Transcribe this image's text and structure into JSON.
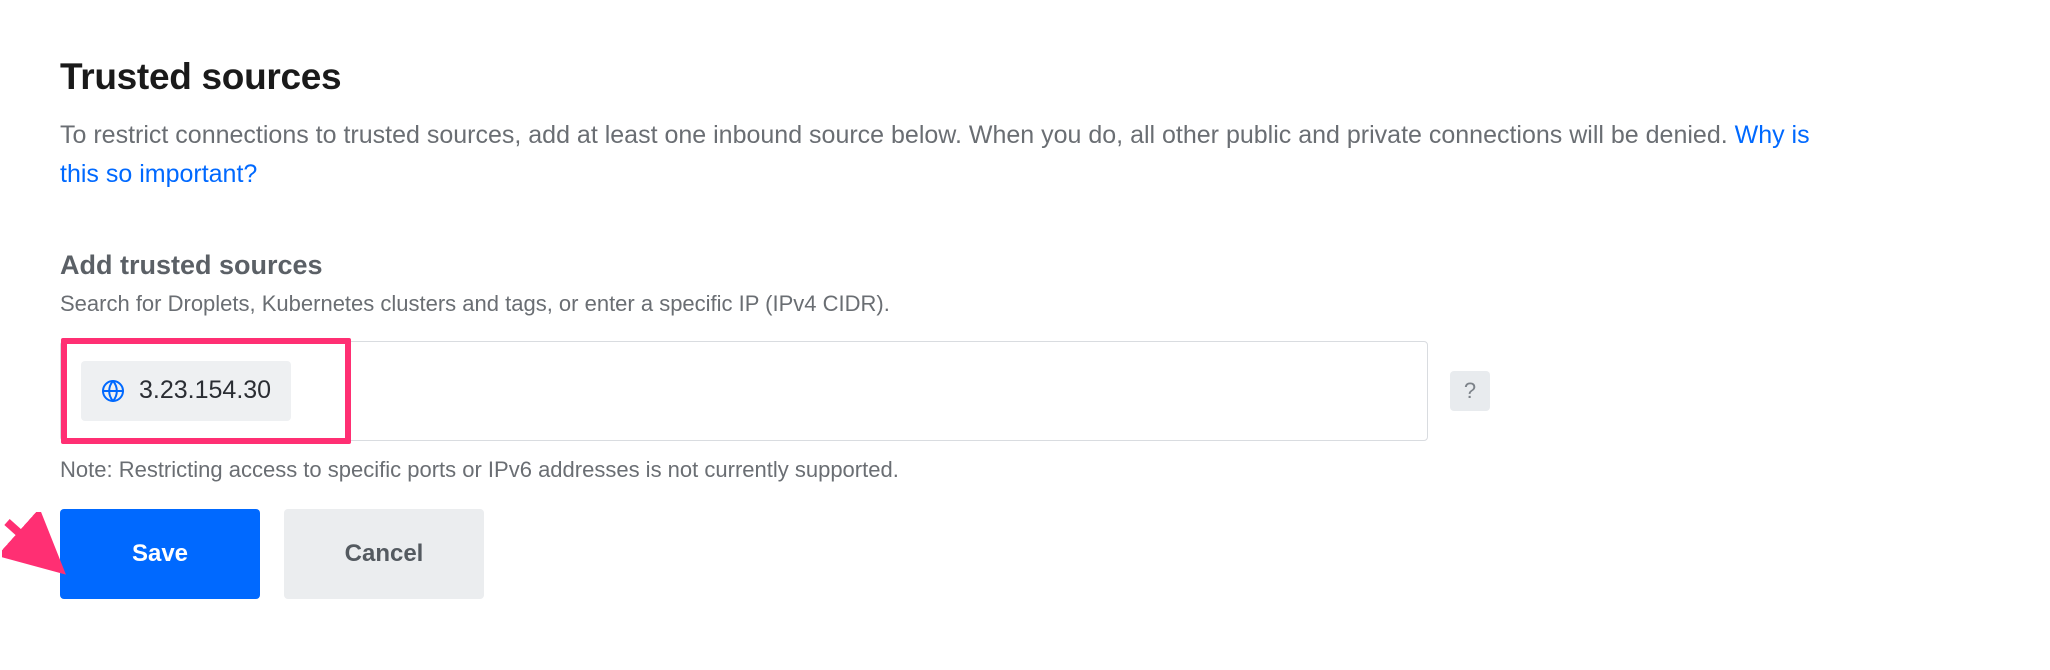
{
  "section": {
    "title": "Trusted sources",
    "description_pre": "To restrict connections to trusted sources, add at least one inbound source below. When you do, all other public and private connections will be denied. ",
    "description_link": "Why is this so important?"
  },
  "form": {
    "subtitle": "Add trusted sources",
    "hint": "Search for Droplets, Kubernetes clusters and tags, or enter a specific IP (IPv4 CIDR).",
    "chip_icon": "globe-icon",
    "chip_value": "3.23.154.30",
    "input_placeholder": "",
    "help_label": "?",
    "note": "Note: Restricting access to specific ports or IPv6 addresses is not currently supported."
  },
  "buttons": {
    "save": "Save",
    "cancel": "Cancel"
  }
}
